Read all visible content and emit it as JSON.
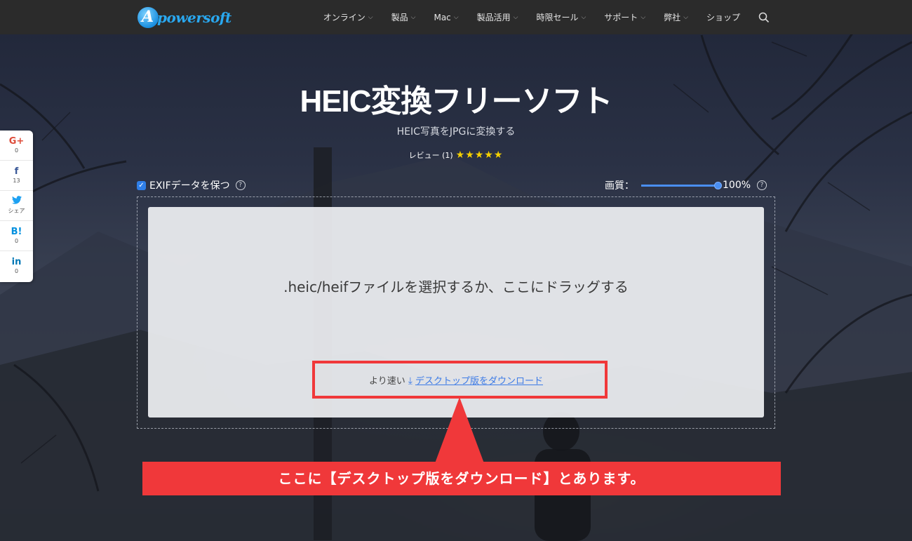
{
  "brand": {
    "logo_text": "powersoft",
    "logo_letter": "A"
  },
  "nav": {
    "items": [
      {
        "label": "オンライン",
        "dropdown": true
      },
      {
        "label": "製品",
        "dropdown": true
      },
      {
        "label": "Mac",
        "dropdown": true
      },
      {
        "label": "製品活用",
        "dropdown": true
      },
      {
        "label": "時限セール",
        "dropdown": true
      },
      {
        "label": "サポート",
        "dropdown": true
      },
      {
        "label": "弊社",
        "dropdown": true
      },
      {
        "label": "ショップ",
        "dropdown": false
      }
    ],
    "search_icon": "search-icon"
  },
  "social": [
    {
      "icon": "G+",
      "name": "google-plus-icon",
      "count": "0",
      "color": "#dd4b39"
    },
    {
      "icon": "f",
      "name": "facebook-icon",
      "count": "13",
      "color": "#3b5998"
    },
    {
      "icon": "🐦",
      "name": "twitter-icon",
      "count": "シェア",
      "color": "#1da1f2"
    },
    {
      "icon": "B!",
      "name": "hatena-icon",
      "count": "0",
      "color": "#008fde"
    },
    {
      "icon": "in",
      "name": "linkedin-icon",
      "count": "0",
      "color": "#0077b5"
    }
  ],
  "hero": {
    "title": "HEIC変換フリーソフト",
    "subtitle": "HEIC写真をJPGに変換する",
    "review_label": "レビュー (1)",
    "rating": 5,
    "stars": "★★★★★"
  },
  "options": {
    "exif_label": "EXIFデータを保つ",
    "exif_checked": true,
    "quality_label": "画質：",
    "quality_value": "100%",
    "quality_fraction": 1.0
  },
  "dropzone": {
    "prompt": ".heic/heifファイルを選択するか、ここにドラッグする",
    "faster_label": "より速い",
    "download_link": "デスクトップ版をダウンロード"
  },
  "callout": {
    "text": "ここに【デスクトップ版をダウンロード】とあります。",
    "color": "#f0383a"
  },
  "colors": {
    "accent": "#2f7fe8",
    "link": "#3d7be6",
    "nav_bg": "#2b2b2b"
  }
}
